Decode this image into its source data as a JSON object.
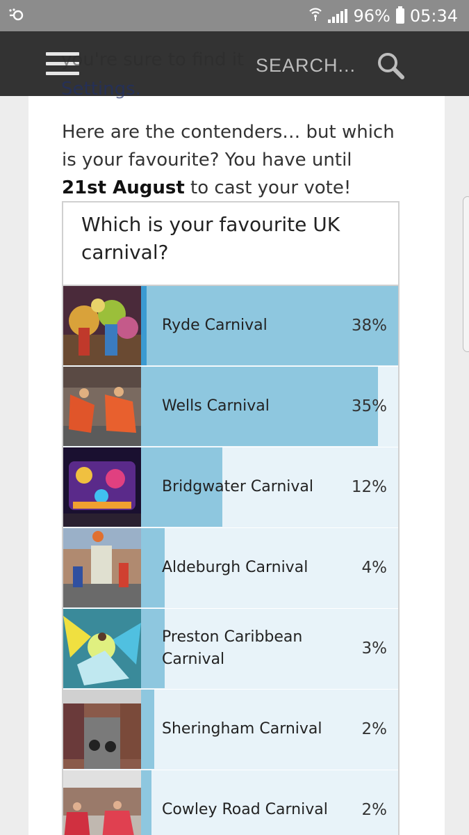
{
  "status": {
    "battery": "96%",
    "time": "05:34",
    "left_icon": "link-icon",
    "wifi_icon": "wifi-icon",
    "signal_icon": "signal-icon",
    "battery_icon": "battery-icon"
  },
  "header": {
    "menu_icon": "hamburger-icon",
    "search_placeholder": "SEARCH...",
    "search_icon": "search-icon",
    "ghost_line1": "you're sure to find it",
    "ghost_line2": "Settings."
  },
  "intro": {
    "text_a": "Here are the contenders… but which is your favourite? You have until ",
    "text_bold_date": "21st August",
    "text_b": " to cast your vote!"
  },
  "poll": {
    "question": "Which is your favourite UK carnival?",
    "options": [
      {
        "label": "Ryde Carnival",
        "percent": "38%",
        "share": 1.0,
        "leading": true
      },
      {
        "label": "Wells Carnival",
        "percent": "35%",
        "share": 0.9211
      },
      {
        "label": "Bridgwater Carnival",
        "percent": "12%",
        "share": 0.3158
      },
      {
        "label": "Aldeburgh Carnival",
        "percent": "4%",
        "share": 0.0921
      },
      {
        "label": "Preston Caribbean Carnival",
        "percent": "3%",
        "share": 0.0921
      },
      {
        "label": "Sheringham Carnival",
        "percent": "2%",
        "share": 0.0526
      },
      {
        "label": "Cowley Road Carnival",
        "percent": "2%",
        "share": 0.0395
      }
    ]
  },
  "colors": {
    "bar": "#8ec7df",
    "bar_track": "#e8f3f9",
    "lead_marker": "#3b9ad1",
    "header_bg": "#333333",
    "status_bg": "#8c8c8c"
  }
}
